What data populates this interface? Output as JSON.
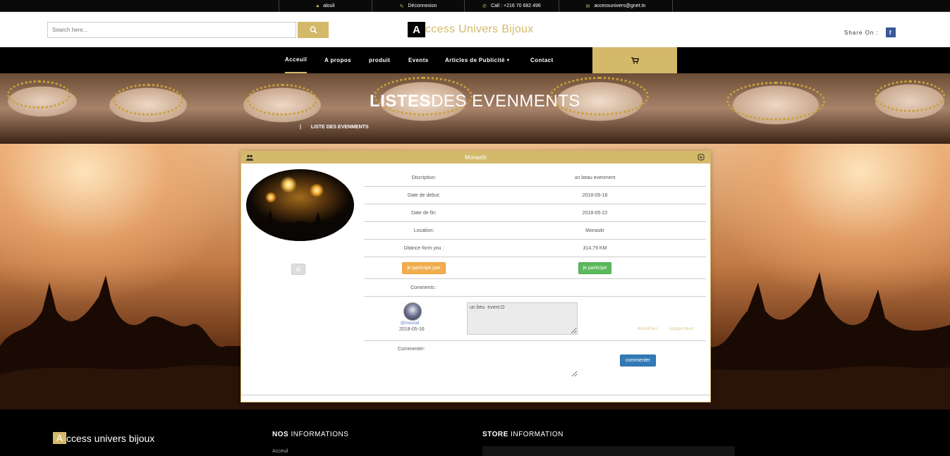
{
  "topbar": {
    "user": "alouli",
    "logout": "Déconnexion",
    "call": "Call : +216 70 682 496",
    "email": "accessunivers@gnet.tn"
  },
  "header": {
    "search_placeholder": "Search here...",
    "logo_letter": "A",
    "logo_rest": "ccess Univers Bijoux",
    "share_label": "Share On :",
    "fb_label": "f"
  },
  "nav": {
    "items": [
      "Acceuil",
      "A propos",
      "produit",
      "Events",
      "Articles de Publicité",
      "Contact"
    ],
    "dropdown_caret": "▾"
  },
  "banner": {
    "title_bold": "LISTES",
    "title_light": "DES EVENMENTS",
    "breadcrumb_sep": "|",
    "breadcrumb": "LISTE DES EVENMENTS"
  },
  "event": {
    "title": "Monastir",
    "rows": [
      {
        "label": "Discription:",
        "value": "un beau evenment"
      },
      {
        "label": "Date de debut:",
        "value": "2018-05-18"
      },
      {
        "label": "Date de fin:",
        "value": "2018-05-22"
      },
      {
        "label": "Location:",
        "value": "Monastir"
      },
      {
        "label": "Ditance form you :",
        "value": "314,79 KM"
      }
    ],
    "btn_not_participate": "je participe pas",
    "btn_participate": "je participe",
    "comments_label": "Comments :",
    "comment": {
      "user": "@mourad",
      "date": "2018-05-16",
      "text": "un beu  event:D",
      "modify": "modifier",
      "delete": "supprimer"
    },
    "commenter_label": "Commenter:",
    "commenter_btn": "commenter"
  },
  "footer": {
    "logo_letter": "A",
    "logo_rest": "ccess univers bijoux",
    "nos_bold": "NOS",
    "nos_rest": "INFORMATIONS",
    "store_bold": "STORE",
    "store_rest": "INFORMATION",
    "link_home": "Acceuil"
  },
  "colors": {
    "accent": "#d4b96a",
    "dark": "#000000",
    "primary_button": "#337ab7",
    "success_button": "#5cb85c",
    "warning_button": "#f0ad4e"
  }
}
